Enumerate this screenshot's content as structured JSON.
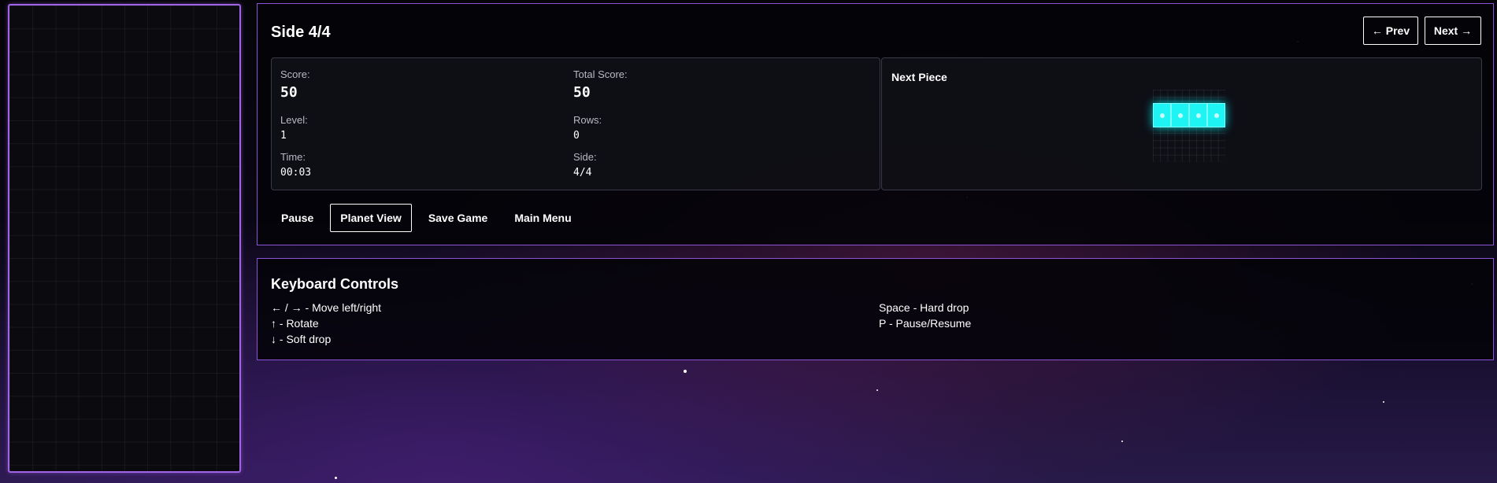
{
  "game": {
    "side_title": "Side 4/4",
    "prev_label": "← Prev",
    "next_label": "Next →",
    "stats": {
      "score_label": "Score:",
      "score_value": "50",
      "total_score_label": "Total Score:",
      "total_score_value": "50",
      "level_label": "Level:",
      "level_value": "1",
      "rows_label": "Rows:",
      "rows_value": "0",
      "time_label": "Time:",
      "time_value": "00:03",
      "side_label": "Side:",
      "side_value": "4/4"
    },
    "next_piece": {
      "title": "Next Piece",
      "piece_type": "I",
      "color": "#1ff4f4"
    },
    "actions": {
      "pause": "Pause",
      "planet_view": "Planet View",
      "save_game": "Save Game",
      "main_menu": "Main Menu"
    }
  },
  "keyboard_controls": {
    "title": "Keyboard Controls",
    "left_column": [
      "← / → - Move left/right",
      "↑ - Rotate",
      "↓ - Soft drop"
    ],
    "right_column": [
      "Space - Hard drop",
      "P - Pause/Resume"
    ]
  },
  "colors": {
    "accent_border": "#a164e8",
    "piece_cyan": "#1ff4f4"
  }
}
